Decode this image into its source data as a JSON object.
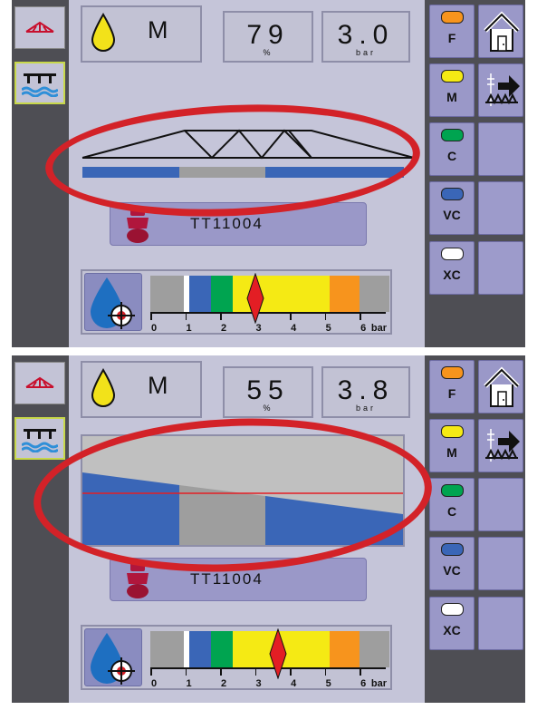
{
  "screens": [
    {
      "rate_label": "M",
      "rate_value": "79",
      "rate_unit": "%",
      "pressure_value": "3.0",
      "pressure_unit": "bar",
      "nozzle_name": "TT11004",
      "pressure_indicator_bar": 3.0,
      "view": "boom-sections"
    },
    {
      "rate_label": "M",
      "rate_value": "55",
      "rate_unit": "%",
      "pressure_value": "3.8",
      "pressure_unit": "bar",
      "nozzle_name": "TT11004",
      "pressure_indicator_bar": 3.65,
      "view": "coverage-graph"
    }
  ],
  "pressure_scale": {
    "ticks": [
      "0",
      "1",
      "2",
      "3",
      "4",
      "5",
      "6"
    ],
    "unit": "bar",
    "zones": [
      {
        "from": 0.0,
        "to": 0.95,
        "color": "#9e9e9e"
      },
      {
        "from": 0.95,
        "to": 1.12,
        "color": "#ffffff"
      },
      {
        "from": 1.12,
        "to": 1.75,
        "color": "#3a66b7"
      },
      {
        "from": 1.75,
        "to": 2.35,
        "color": "#00a450"
      },
      {
        "from": 2.35,
        "to": 5.15,
        "color": "#f5ea14"
      },
      {
        "from": 5.15,
        "to": 6.0,
        "color": "#f7941d"
      },
      {
        "from": 6.0,
        "to": 6.85,
        "color": "#9e9e9e"
      }
    ]
  },
  "nozzle_classes": [
    {
      "label": "F",
      "color": "#f7941d"
    },
    {
      "label": "M",
      "color": "#f5ea14"
    },
    {
      "label": "C",
      "color": "#00a450"
    },
    {
      "label": "VC",
      "color": "#3a66b7"
    },
    {
      "label": "XC",
      "color": "#ffffff"
    }
  ],
  "colors": {
    "highlight_oval": "#d32228",
    "section_blue": "#3a66b7",
    "section_gray": "#9e9e9e",
    "indicator_red": "#e31e24"
  }
}
